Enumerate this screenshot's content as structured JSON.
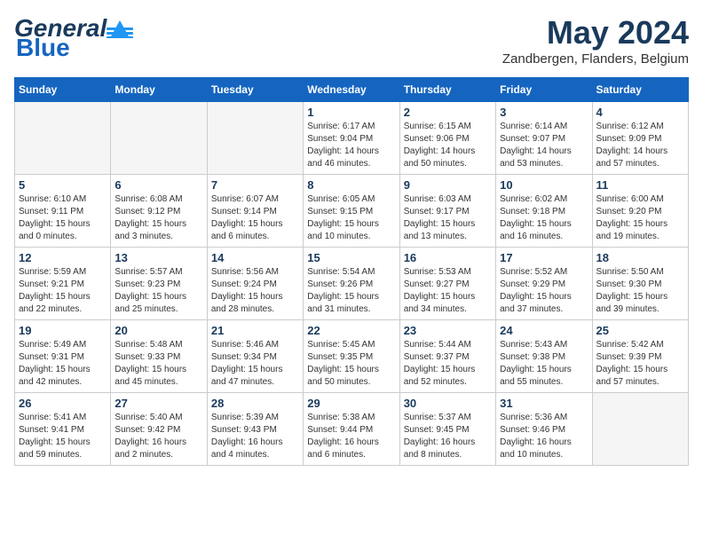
{
  "header": {
    "logo_general": "General",
    "logo_blue": "Blue",
    "month_title": "May 2024",
    "subtitle": "Zandbergen, Flanders, Belgium"
  },
  "weekdays": [
    "Sunday",
    "Monday",
    "Tuesday",
    "Wednesday",
    "Thursday",
    "Friday",
    "Saturday"
  ],
  "weeks": [
    [
      {
        "day": "",
        "info": ""
      },
      {
        "day": "",
        "info": ""
      },
      {
        "day": "",
        "info": ""
      },
      {
        "day": "1",
        "info": "Sunrise: 6:17 AM\nSunset: 9:04 PM\nDaylight: 14 hours\nand 46 minutes."
      },
      {
        "day": "2",
        "info": "Sunrise: 6:15 AM\nSunset: 9:06 PM\nDaylight: 14 hours\nand 50 minutes."
      },
      {
        "day": "3",
        "info": "Sunrise: 6:14 AM\nSunset: 9:07 PM\nDaylight: 14 hours\nand 53 minutes."
      },
      {
        "day": "4",
        "info": "Sunrise: 6:12 AM\nSunset: 9:09 PM\nDaylight: 14 hours\nand 57 minutes."
      }
    ],
    [
      {
        "day": "5",
        "info": "Sunrise: 6:10 AM\nSunset: 9:11 PM\nDaylight: 15 hours\nand 0 minutes."
      },
      {
        "day": "6",
        "info": "Sunrise: 6:08 AM\nSunset: 9:12 PM\nDaylight: 15 hours\nand 3 minutes."
      },
      {
        "day": "7",
        "info": "Sunrise: 6:07 AM\nSunset: 9:14 PM\nDaylight: 15 hours\nand 6 minutes."
      },
      {
        "day": "8",
        "info": "Sunrise: 6:05 AM\nSunset: 9:15 PM\nDaylight: 15 hours\nand 10 minutes."
      },
      {
        "day": "9",
        "info": "Sunrise: 6:03 AM\nSunset: 9:17 PM\nDaylight: 15 hours\nand 13 minutes."
      },
      {
        "day": "10",
        "info": "Sunrise: 6:02 AM\nSunset: 9:18 PM\nDaylight: 15 hours\nand 16 minutes."
      },
      {
        "day": "11",
        "info": "Sunrise: 6:00 AM\nSunset: 9:20 PM\nDaylight: 15 hours\nand 19 minutes."
      }
    ],
    [
      {
        "day": "12",
        "info": "Sunrise: 5:59 AM\nSunset: 9:21 PM\nDaylight: 15 hours\nand 22 minutes."
      },
      {
        "day": "13",
        "info": "Sunrise: 5:57 AM\nSunset: 9:23 PM\nDaylight: 15 hours\nand 25 minutes."
      },
      {
        "day": "14",
        "info": "Sunrise: 5:56 AM\nSunset: 9:24 PM\nDaylight: 15 hours\nand 28 minutes."
      },
      {
        "day": "15",
        "info": "Sunrise: 5:54 AM\nSunset: 9:26 PM\nDaylight: 15 hours\nand 31 minutes."
      },
      {
        "day": "16",
        "info": "Sunrise: 5:53 AM\nSunset: 9:27 PM\nDaylight: 15 hours\nand 34 minutes."
      },
      {
        "day": "17",
        "info": "Sunrise: 5:52 AM\nSunset: 9:29 PM\nDaylight: 15 hours\nand 37 minutes."
      },
      {
        "day": "18",
        "info": "Sunrise: 5:50 AM\nSunset: 9:30 PM\nDaylight: 15 hours\nand 39 minutes."
      }
    ],
    [
      {
        "day": "19",
        "info": "Sunrise: 5:49 AM\nSunset: 9:31 PM\nDaylight: 15 hours\nand 42 minutes."
      },
      {
        "day": "20",
        "info": "Sunrise: 5:48 AM\nSunset: 9:33 PM\nDaylight: 15 hours\nand 45 minutes."
      },
      {
        "day": "21",
        "info": "Sunrise: 5:46 AM\nSunset: 9:34 PM\nDaylight: 15 hours\nand 47 minutes."
      },
      {
        "day": "22",
        "info": "Sunrise: 5:45 AM\nSunset: 9:35 PM\nDaylight: 15 hours\nand 50 minutes."
      },
      {
        "day": "23",
        "info": "Sunrise: 5:44 AM\nSunset: 9:37 PM\nDaylight: 15 hours\nand 52 minutes."
      },
      {
        "day": "24",
        "info": "Sunrise: 5:43 AM\nSunset: 9:38 PM\nDaylight: 15 hours\nand 55 minutes."
      },
      {
        "day": "25",
        "info": "Sunrise: 5:42 AM\nSunset: 9:39 PM\nDaylight: 15 hours\nand 57 minutes."
      }
    ],
    [
      {
        "day": "26",
        "info": "Sunrise: 5:41 AM\nSunset: 9:41 PM\nDaylight: 15 hours\nand 59 minutes."
      },
      {
        "day": "27",
        "info": "Sunrise: 5:40 AM\nSunset: 9:42 PM\nDaylight: 16 hours\nand 2 minutes."
      },
      {
        "day": "28",
        "info": "Sunrise: 5:39 AM\nSunset: 9:43 PM\nDaylight: 16 hours\nand 4 minutes."
      },
      {
        "day": "29",
        "info": "Sunrise: 5:38 AM\nSunset: 9:44 PM\nDaylight: 16 hours\nand 6 minutes."
      },
      {
        "day": "30",
        "info": "Sunrise: 5:37 AM\nSunset: 9:45 PM\nDaylight: 16 hours\nand 8 minutes."
      },
      {
        "day": "31",
        "info": "Sunrise: 5:36 AM\nSunset: 9:46 PM\nDaylight: 16 hours\nand 10 minutes."
      },
      {
        "day": "",
        "info": ""
      }
    ]
  ]
}
